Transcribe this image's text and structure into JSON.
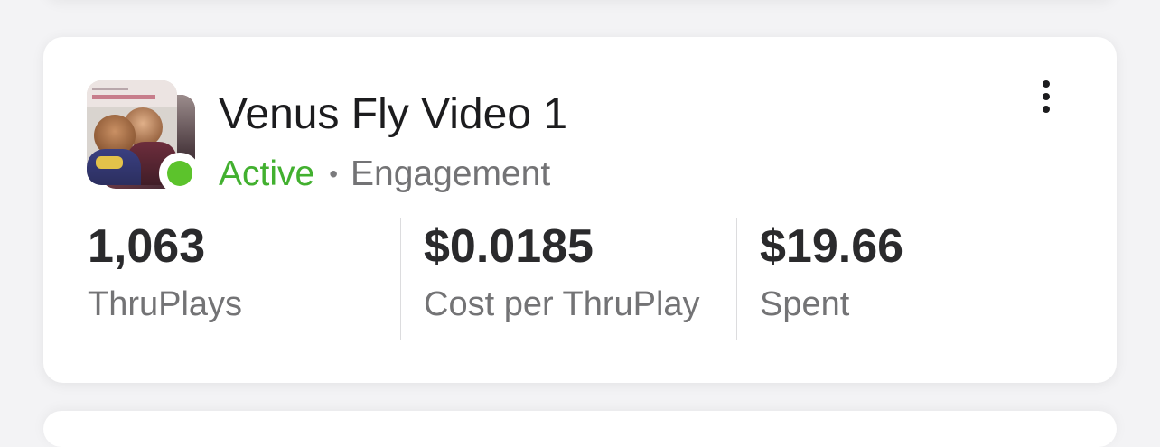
{
  "campaign": {
    "title": "Venus Fly Video 1",
    "status": "Active",
    "separator": "•",
    "objective": "Engagement"
  },
  "metrics": [
    {
      "value": "1,063",
      "label": "ThruPlays"
    },
    {
      "value": "$0.0185",
      "label": "Cost per ThruPlay"
    },
    {
      "value": "$19.66",
      "label": "Spent"
    }
  ],
  "icons": {
    "more": "more-vertical-icon",
    "status": "status-dot-icon"
  },
  "colors": {
    "status_active": "#42b02f",
    "status_dot": "#5cc32c",
    "text_primary": "#1c1c1e",
    "text_secondary": "#737375"
  }
}
